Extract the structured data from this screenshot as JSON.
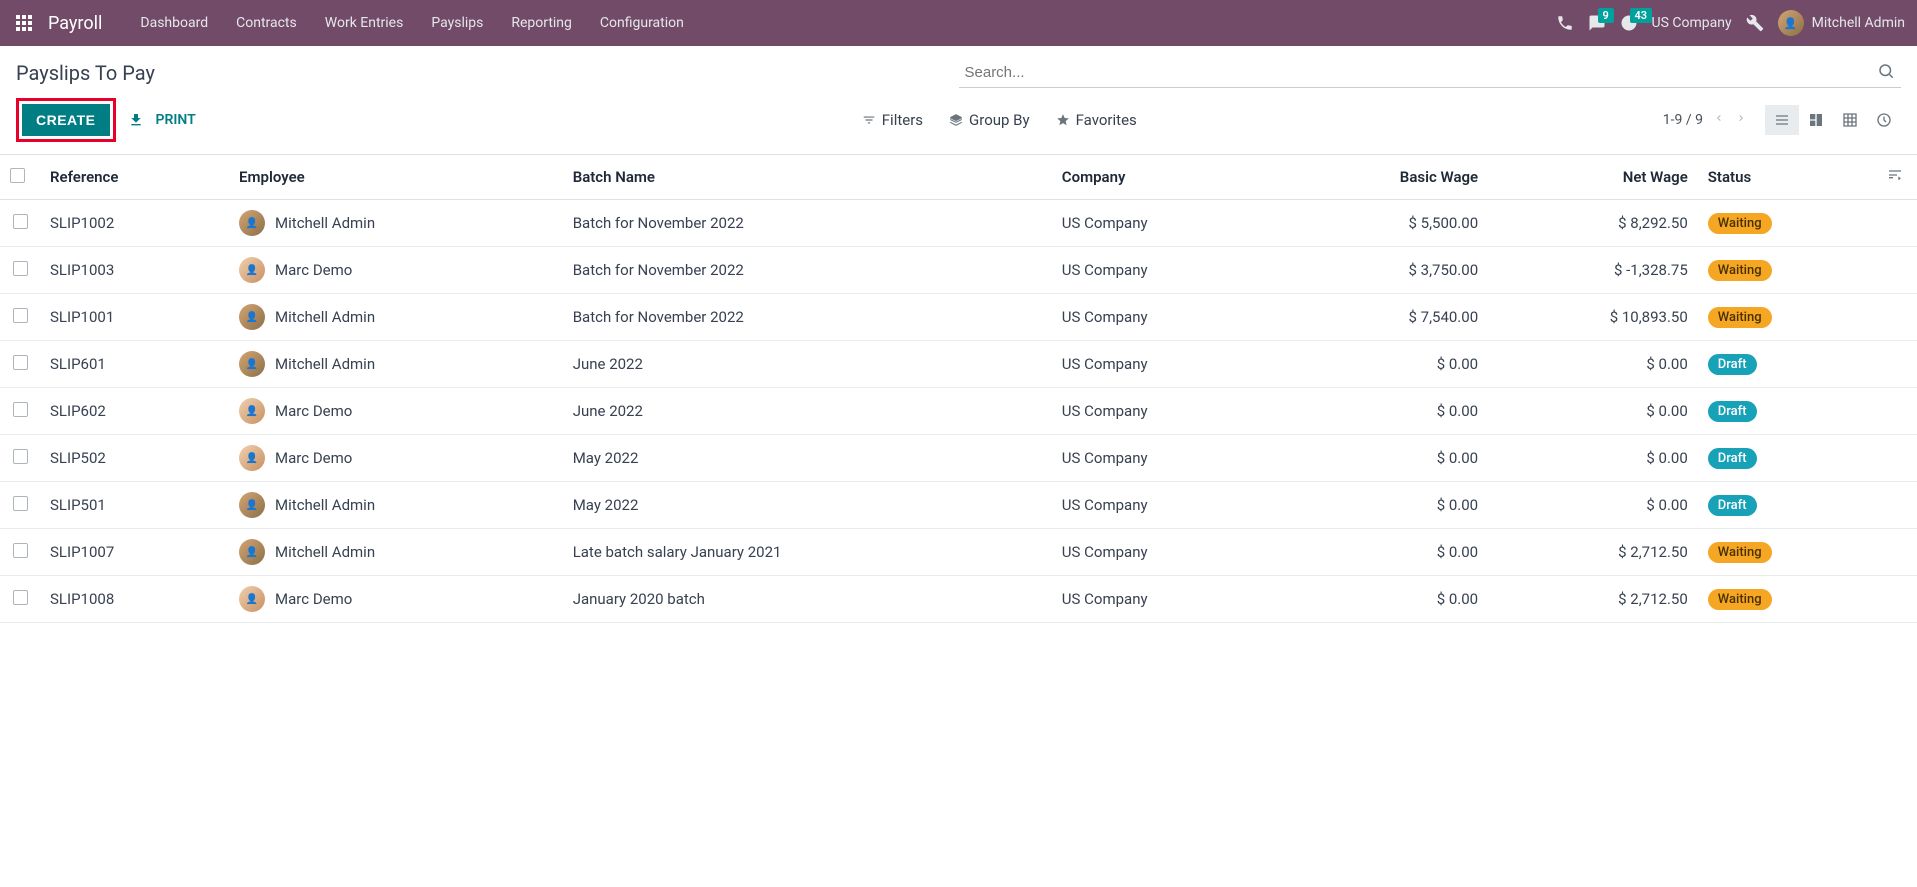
{
  "navbar": {
    "app_name": "Payroll",
    "menu": [
      "Dashboard",
      "Contracts",
      "Work Entries",
      "Payslips",
      "Reporting",
      "Configuration"
    ],
    "messages_badge": "9",
    "activities_badge": "43",
    "company": "US Company",
    "user": "Mitchell Admin"
  },
  "breadcrumb": "Payslips To Pay",
  "buttons": {
    "create": "CREATE",
    "print": "PRINT"
  },
  "search": {
    "placeholder": "Search...",
    "filters": "Filters",
    "group_by": "Group By",
    "favorites": "Favorites"
  },
  "pager": "1-9 / 9",
  "columns": {
    "reference": "Reference",
    "employee": "Employee",
    "batch": "Batch Name",
    "company": "Company",
    "basic_wage": "Basic Wage",
    "net_wage": "Net Wage",
    "status": "Status"
  },
  "rows": [
    {
      "ref": "SLIP1002",
      "employee": "Mitchell Admin",
      "avatar": "a1",
      "batch": "Batch for November 2022",
      "company": "US Company",
      "basic": "$ 5,500.00",
      "net": "$ 8,292.50",
      "status": "Waiting",
      "status_class": "status-waiting"
    },
    {
      "ref": "SLIP1003",
      "employee": "Marc Demo",
      "avatar": "a2",
      "batch": "Batch for November 2022",
      "company": "US Company",
      "basic": "$ 3,750.00",
      "net": "$ -1,328.75",
      "status": "Waiting",
      "status_class": "status-waiting"
    },
    {
      "ref": "SLIP1001",
      "employee": "Mitchell Admin",
      "avatar": "a1",
      "batch": "Batch for November 2022",
      "company": "US Company",
      "basic": "$ 7,540.00",
      "net": "$ 10,893.50",
      "status": "Waiting",
      "status_class": "status-waiting"
    },
    {
      "ref": "SLIP601",
      "employee": "Mitchell Admin",
      "avatar": "a1",
      "batch": "June 2022",
      "company": "US Company",
      "basic": "$ 0.00",
      "net": "$ 0.00",
      "status": "Draft",
      "status_class": "status-draft"
    },
    {
      "ref": "SLIP602",
      "employee": "Marc Demo",
      "avatar": "a2",
      "batch": "June 2022",
      "company": "US Company",
      "basic": "$ 0.00",
      "net": "$ 0.00",
      "status": "Draft",
      "status_class": "status-draft"
    },
    {
      "ref": "SLIP502",
      "employee": "Marc Demo",
      "avatar": "a2",
      "batch": "May 2022",
      "company": "US Company",
      "basic": "$ 0.00",
      "net": "$ 0.00",
      "status": "Draft",
      "status_class": "status-draft"
    },
    {
      "ref": "SLIP501",
      "employee": "Mitchell Admin",
      "avatar": "a1",
      "batch": "May 2022",
      "company": "US Company",
      "basic": "$ 0.00",
      "net": "$ 0.00",
      "status": "Draft",
      "status_class": "status-draft"
    },
    {
      "ref": "SLIP1007",
      "employee": "Mitchell Admin",
      "avatar": "a1",
      "batch": "Late batch salary January 2021",
      "company": "US Company",
      "basic": "$ 0.00",
      "net": "$ 2,712.50",
      "status": "Waiting",
      "status_class": "status-waiting"
    },
    {
      "ref": "SLIP1008",
      "employee": "Marc Demo",
      "avatar": "a2",
      "batch": "January 2020 batch",
      "company": "US Company",
      "basic": "$ 0.00",
      "net": "$ 2,712.50",
      "status": "Waiting",
      "status_class": "status-waiting"
    }
  ]
}
